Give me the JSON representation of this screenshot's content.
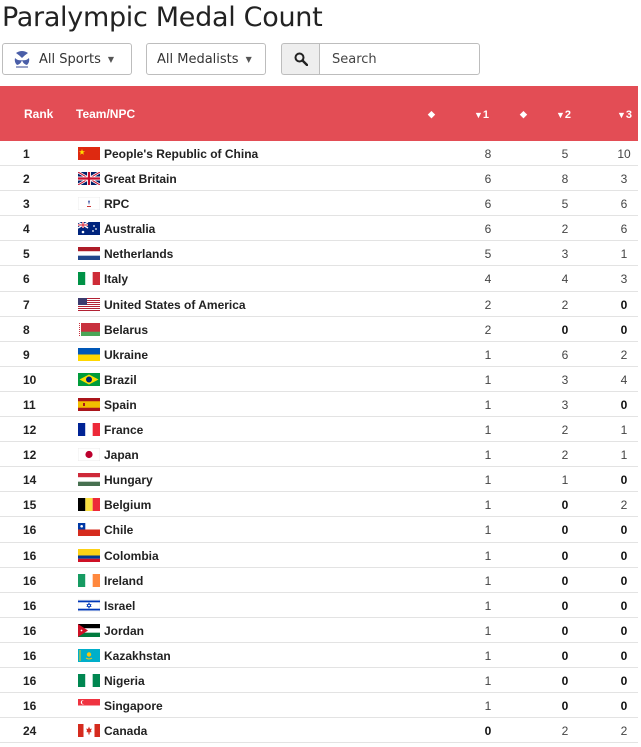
{
  "title": "Paralympic Medal Count",
  "filters": {
    "sports_label": "All Sports",
    "medalists_label": "All Medalists",
    "search_placeholder": "Search"
  },
  "table": {
    "headers": {
      "rank": "Rank",
      "team": "Team/NPC",
      "gold": "1",
      "silver": "2",
      "bronze": "3"
    },
    "header_color": "#e34d55",
    "rows": [
      {
        "rank": "1",
        "name": "People's Republic of China",
        "flag": "china-flag-icon",
        "gold": "8",
        "silver": "5",
        "bronze": "10"
      },
      {
        "rank": "2",
        "name": "Great Britain",
        "flag": "great-britain-flag-icon",
        "gold": "6",
        "silver": "8",
        "bronze": "3"
      },
      {
        "rank": "3",
        "name": "RPC",
        "flag": "rpc-flag-icon",
        "gold": "6",
        "silver": "5",
        "bronze": "6"
      },
      {
        "rank": "4",
        "name": "Australia",
        "flag": "australia-flag-icon",
        "gold": "6",
        "silver": "2",
        "bronze": "6"
      },
      {
        "rank": "5",
        "name": "Netherlands",
        "flag": "netherlands-flag-icon",
        "gold": "5",
        "silver": "3",
        "bronze": "1"
      },
      {
        "rank": "6",
        "name": "Italy",
        "flag": "italy-flag-icon",
        "gold": "4",
        "silver": "4",
        "bronze": "3"
      },
      {
        "rank": "7",
        "name": "United States of America",
        "flag": "usa-flag-icon",
        "gold": "2",
        "silver": "2",
        "bronze": "0"
      },
      {
        "rank": "8",
        "name": "Belarus",
        "flag": "belarus-flag-icon",
        "gold": "2",
        "silver": "0",
        "bronze": "0"
      },
      {
        "rank": "9",
        "name": "Ukraine",
        "flag": "ukraine-flag-icon",
        "gold": "1",
        "silver": "6",
        "bronze": "2"
      },
      {
        "rank": "10",
        "name": "Brazil",
        "flag": "brazil-flag-icon",
        "gold": "1",
        "silver": "3",
        "bronze": "4"
      },
      {
        "rank": "11",
        "name": "Spain",
        "flag": "spain-flag-icon",
        "gold": "1",
        "silver": "3",
        "bronze": "0"
      },
      {
        "rank": "12",
        "name": "France",
        "flag": "france-flag-icon",
        "gold": "1",
        "silver": "2",
        "bronze": "1"
      },
      {
        "rank": "12",
        "name": "Japan",
        "flag": "japan-flag-icon",
        "gold": "1",
        "silver": "2",
        "bronze": "1"
      },
      {
        "rank": "14",
        "name": "Hungary",
        "flag": "hungary-flag-icon",
        "gold": "1",
        "silver": "1",
        "bronze": "0"
      },
      {
        "rank": "15",
        "name": "Belgium",
        "flag": "belgium-flag-icon",
        "gold": "1",
        "silver": "0",
        "bronze": "2"
      },
      {
        "rank": "16",
        "name": "Chile",
        "flag": "chile-flag-icon",
        "gold": "1",
        "silver": "0",
        "bronze": "0"
      },
      {
        "rank": "16",
        "name": "Colombia",
        "flag": "colombia-flag-icon",
        "gold": "1",
        "silver": "0",
        "bronze": "0"
      },
      {
        "rank": "16",
        "name": "Ireland",
        "flag": "ireland-flag-icon",
        "gold": "1",
        "silver": "0",
        "bronze": "0"
      },
      {
        "rank": "16",
        "name": "Israel",
        "flag": "israel-flag-icon",
        "gold": "1",
        "silver": "0",
        "bronze": "0"
      },
      {
        "rank": "16",
        "name": "Jordan",
        "flag": "jordan-flag-icon",
        "gold": "1",
        "silver": "0",
        "bronze": "0"
      },
      {
        "rank": "16",
        "name": "Kazakhstan",
        "flag": "kazakhstan-flag-icon",
        "gold": "1",
        "silver": "0",
        "bronze": "0"
      },
      {
        "rank": "16",
        "name": "Nigeria",
        "flag": "nigeria-flag-icon",
        "gold": "1",
        "silver": "0",
        "bronze": "0"
      },
      {
        "rank": "16",
        "name": "Singapore",
        "flag": "singapore-flag-icon",
        "gold": "1",
        "silver": "0",
        "bronze": "0"
      },
      {
        "rank": "24",
        "name": "Canada",
        "flag": "canada-flag-icon",
        "gold": "0",
        "silver": "2",
        "bronze": "2"
      }
    ]
  }
}
